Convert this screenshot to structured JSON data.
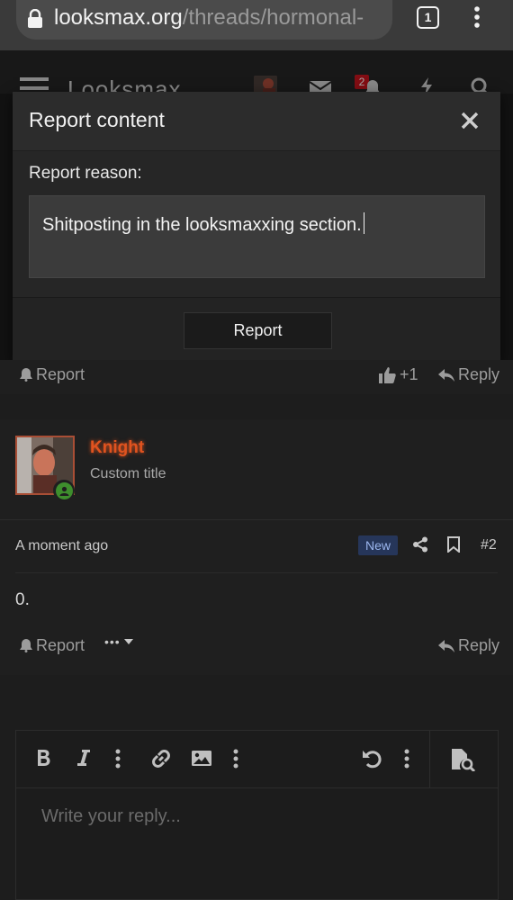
{
  "browser": {
    "url_host": "looksmax.org",
    "url_path": "/threads/hormonal-",
    "tab_count": "1"
  },
  "site": {
    "logo_text": "Looksmax",
    "alerts_count": "2"
  },
  "modal": {
    "title": "Report content",
    "reason_label": "Report reason:",
    "reason_value": "Shitposting in the looksmaxxing section.",
    "submit_label": "Report"
  },
  "post1": {
    "report_label": "Report",
    "reaction_label": "+1",
    "reply_label": "Reply"
  },
  "post2": {
    "username": "Knight",
    "user_title": "Custom title",
    "time": "A moment ago",
    "new_badge": "New",
    "post_number": "#2",
    "body": "0.",
    "report_label": "Report",
    "more_label": "•••",
    "reply_label": "Reply"
  },
  "editor": {
    "placeholder": "Write your reply..."
  },
  "colors": {
    "background": "#1d1d1d",
    "username": "#e0531f",
    "new_badge_bg": "#26365a",
    "online": "#3e8e2d",
    "alert_badge": "#c8141e"
  }
}
